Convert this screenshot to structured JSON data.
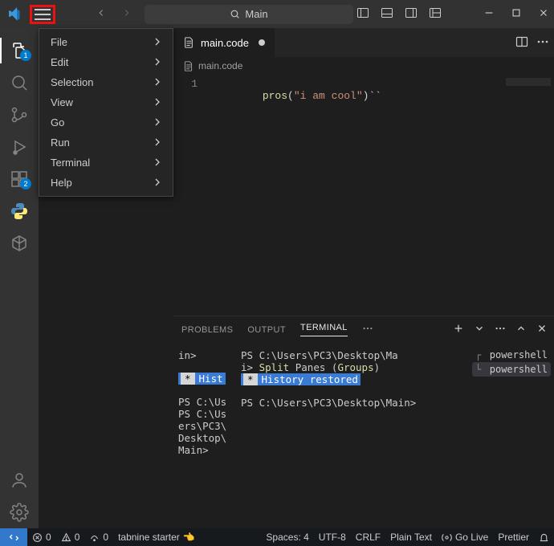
{
  "titlebar": {
    "search_text": "Main"
  },
  "menu": {
    "items": [
      {
        "label": "File"
      },
      {
        "label": "Edit"
      },
      {
        "label": "Selection"
      },
      {
        "label": "View"
      },
      {
        "label": "Go"
      },
      {
        "label": "Run"
      },
      {
        "label": "Terminal"
      },
      {
        "label": "Help"
      }
    ]
  },
  "activity": {
    "explorer_badge": "1",
    "ext_badge": "2"
  },
  "tab": {
    "filename": "main.code",
    "breadcrumb": "main.code"
  },
  "editor": {
    "line_number": "1",
    "code_fn": "pros",
    "code_paren_open": "(",
    "code_str": "\"i am cool\"",
    "code_rest": ")``"
  },
  "panel": {
    "tabs": {
      "problems": "PROBLEMS",
      "output": "OUTPUT",
      "terminal": "TERMINAL"
    }
  },
  "terminal_left": {
    "l1": "in>",
    "hist_star": "*",
    "hist_text": "Hist",
    "p1": "PS C:\\Us",
    "p2": "ers\\PC3\\",
    "p3": "Desktop\\",
    "p4": "Main>"
  },
  "terminal_mid": {
    "l1": "PS C:\\Users\\PC3\\Desktop\\Ma",
    "l2_pre": "i> ",
    "l2_cmd": "Split",
    "l2_mid": " Panes (",
    "l2_grp": "Groups",
    "l2_end": ")",
    "hist_star": "*",
    "hist_text": "History restored",
    "p1": "PS C:\\Users\\PC3\\Desktop\\Main>"
  },
  "terminal_side": {
    "row1": "powershell",
    "row2": "powershell"
  },
  "statusbar": {
    "errors": "0",
    "warnings": "0",
    "ports": "0",
    "tabnine": "tabnine starter",
    "spaces": "Spaces: 4",
    "encoding": "UTF-8",
    "eol": "CRLF",
    "lang": "Plain Text",
    "golive": "Go Live",
    "prettier": "Prettier"
  }
}
